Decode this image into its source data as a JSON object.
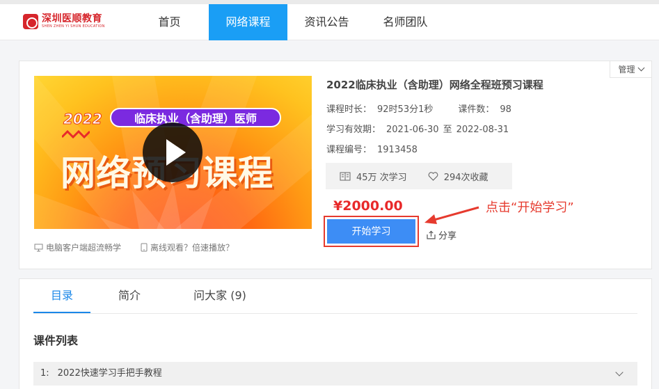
{
  "header": {
    "logo_name": "深圳医顺教育",
    "logo_sub": "SHEN ZHEN YI SHUN EDUCATION",
    "nav": [
      {
        "label": "首页",
        "active": false
      },
      {
        "label": "网络课程",
        "active": true
      },
      {
        "label": "资讯公告",
        "active": false
      },
      {
        "label": "名师团队",
        "active": false
      }
    ],
    "active_color": "#1a9ef5"
  },
  "course": {
    "manage_label": "管理",
    "cover": {
      "year": "2022",
      "badge": "临床执业（含助理）医师",
      "title": "网络预习课程"
    },
    "tips": [
      "电脑客户端超流畅学",
      "离线观看？倍速播放？"
    ],
    "title": "2022临床执业（含助理）网络全程班预习课程",
    "duration_label": "课程时长：",
    "duration_value": "92时53分1秒",
    "count_label": "课件数：",
    "count_value": "98",
    "validity_label": "学习有效期：",
    "validity_start": "2021-06-30",
    "validity_to": "至",
    "validity_end": "2022-08-31",
    "code_label": "课程编号：",
    "code_value": "1913458",
    "learners": "45万 次学习",
    "favorites": "294次收藏",
    "price": "¥2000.00",
    "start_label": "开始学习",
    "share_label": "分享",
    "annotation": "点击“开始学习”",
    "price_color": "#e8292a",
    "button_color": "#3d8df5",
    "annotation_color": "#e63a2e"
  },
  "panel": {
    "tabs": [
      {
        "label": "目录",
        "active": true
      },
      {
        "label": "简介",
        "active": false
      },
      {
        "label": "问大家 (9)",
        "active": false
      }
    ],
    "list_title": "课件列表",
    "lessons": [
      {
        "num": "1:",
        "title": "2022快速学习手把手教程"
      }
    ]
  }
}
